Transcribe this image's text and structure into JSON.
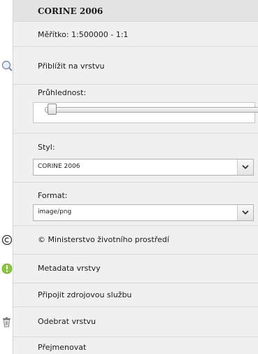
{
  "layer": {
    "title": "CORINE 2006",
    "scale": "Měřítko: 1:500000 - 1:1",
    "zoom_label": "Přiblížit na vrstvu",
    "opacity_label": "Průhlednost:",
    "opacity_value": 0,
    "style_label": "Styl:",
    "style_value": "CORINE 2006",
    "format_label": "Format:",
    "format_value": "image/png",
    "copyright": "© Ministerstvo životního prostředí",
    "metadata": "Metadata vrstvy",
    "connect_source": "Připojit zdrojovou službu",
    "remove": "Odebrat vrstvu",
    "rename": "Přejmenovat"
  },
  "icons": {
    "zoom": "magnifier-icon",
    "copyright": "copyright-icon",
    "metadata": "info-icon",
    "remove": "trash-icon",
    "dropdown": "chevron-down-icon"
  },
  "colors": {
    "panel_bg": "#f0f0f0",
    "title_bg": "#e3e3e3",
    "metadata_icon": "#8cc63f"
  }
}
